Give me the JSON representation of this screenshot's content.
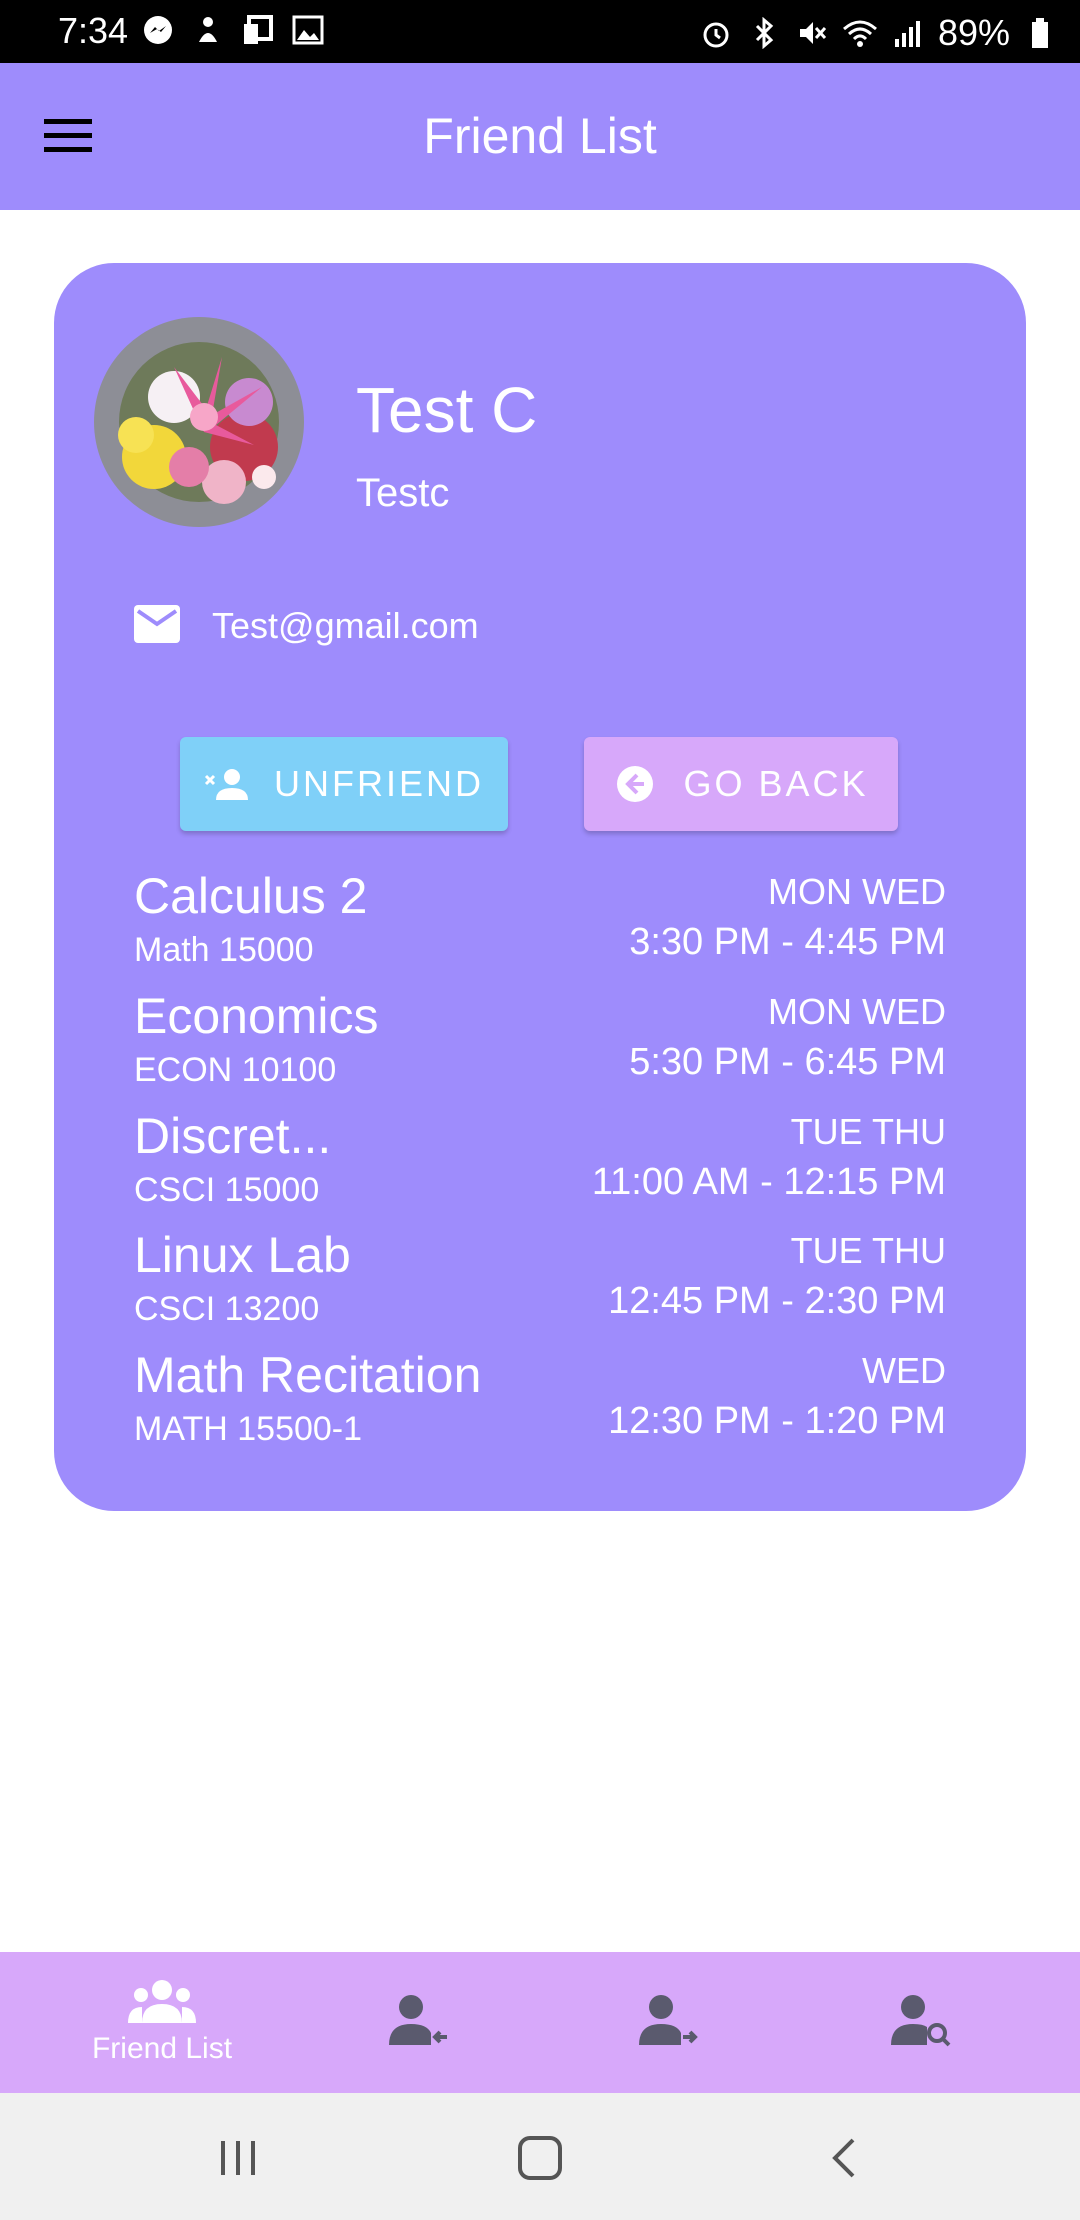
{
  "status_bar": {
    "time": "7:34",
    "battery": "89%",
    "left_icons": [
      "messenger-icon",
      "notification-icon",
      "cast-icon",
      "gallery-icon"
    ],
    "right_icons": [
      "alarm-icon",
      "bluetooth-icon",
      "mute-icon",
      "wifi-icon",
      "signal-icon",
      "battery-icon"
    ]
  },
  "app_bar": {
    "title": "Friend List"
  },
  "profile": {
    "name": "Test C",
    "username": "Testc",
    "email": "Test@gmail.com"
  },
  "buttons": {
    "unfriend": "UNFRIEND",
    "go_back": "GO BACK"
  },
  "courses": [
    {
      "name": "Calculus 2",
      "code": "Math 15000",
      "days": "MON WED",
      "time": "3:30 PM - 4:45 PM"
    },
    {
      "name": "Economics",
      "code": "ECON 10100",
      "days": "MON WED",
      "time": "5:30 PM - 6:45 PM"
    },
    {
      "name": "Discret...",
      "code": "CSCI 15000",
      "days": "TUE THU",
      "time": "11:00 AM - 12:15 PM"
    },
    {
      "name": "Linux Lab",
      "code": "CSCI 13200",
      "days": "TUE THU",
      "time": "12:45 PM - 2:30 PM"
    },
    {
      "name": "Math Recitation",
      "code": "MATH 15500-1",
      "days": "WED",
      "time": "12:30 PM - 1:20 PM"
    }
  ],
  "bottom_nav": {
    "items": [
      {
        "label": "Friend List",
        "icon": "people-icon",
        "active": true
      },
      {
        "label": "",
        "icon": "incoming-request-icon",
        "active": false
      },
      {
        "label": "",
        "icon": "outgoing-request-icon",
        "active": false
      },
      {
        "label": "",
        "icon": "search-user-icon",
        "active": false
      }
    ]
  },
  "colors": {
    "primary": "#9e8cfc",
    "accent_pink": "#d7a8fa",
    "accent_blue": "#7fd0f8",
    "nav_icon_inactive": "#5a5a6e"
  }
}
